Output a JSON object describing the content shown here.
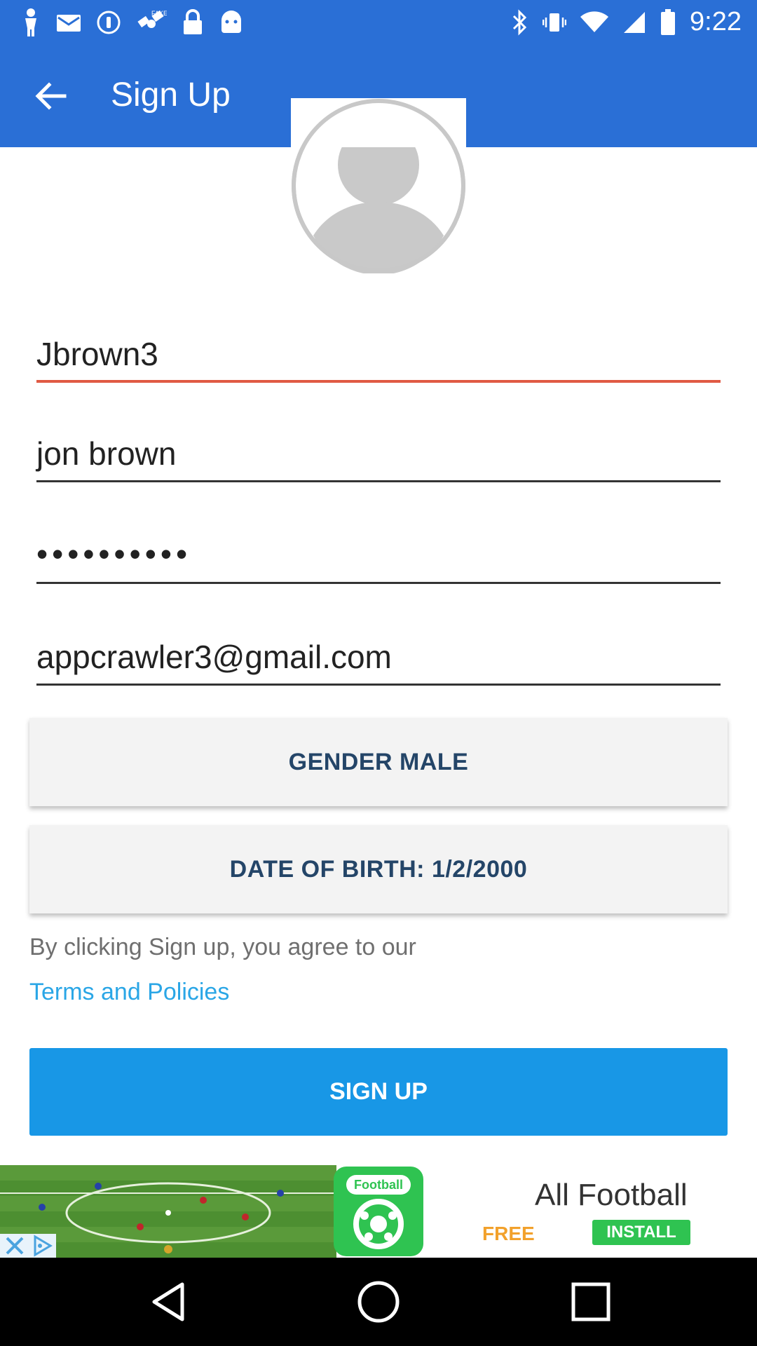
{
  "status_bar": {
    "time": "9:22",
    "left_icons": [
      "person-icon",
      "mail-icon",
      "info-icon",
      "satellite-icon",
      "lock-icon",
      "android-icon"
    ],
    "right_icons": [
      "bluetooth-icon",
      "vibrate-icon",
      "wifi-icon",
      "signal-icon",
      "battery-icon"
    ]
  },
  "app_bar": {
    "title": "Sign Up",
    "back_icon": "arrow-back-icon",
    "color": "#2a6fd6"
  },
  "form": {
    "username": "Jbrown3",
    "full_name": "jon brown",
    "password_mask": "••••••••••",
    "email": "appcrawler3@gmail.com",
    "gender_button": "GENDER MALE",
    "dob_button": "DATE OF BIRTH: 1/2/2000",
    "agree_text": "By clicking Sign up, you agree to our",
    "terms_link": "Terms and Policies",
    "signup_button": "SIGN UP",
    "active_underline_color": "#e05a44",
    "accent_color": "#1897e6"
  },
  "ad_banner": {
    "logo_label": "Football",
    "title": "All Football",
    "free_label": "FREE",
    "install_label": "INSTALL"
  },
  "nav_bar": {
    "buttons": [
      "back-triangle-icon",
      "home-circle-icon",
      "recents-square-icon"
    ]
  }
}
